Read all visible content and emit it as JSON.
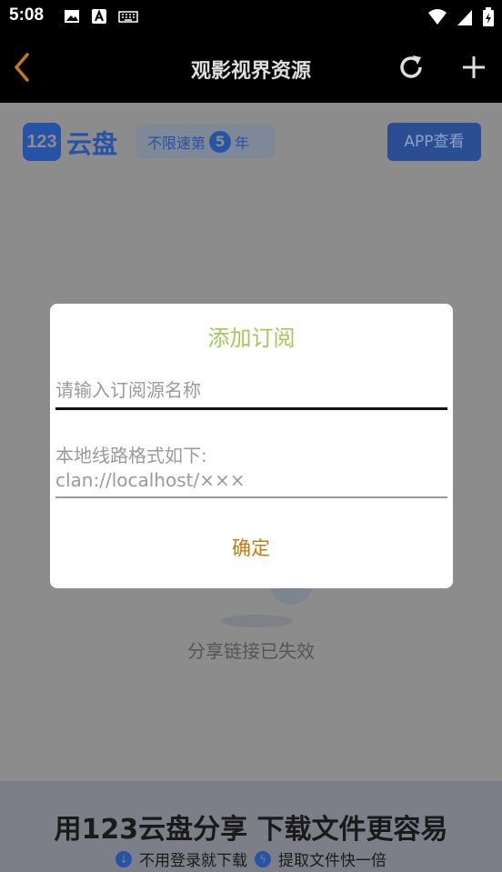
{
  "status_bar": {
    "time": "5:08"
  },
  "app_bar": {
    "title": "观影视界资源"
  },
  "page": {
    "logo_number": "123",
    "logo_text": "云盘",
    "promo_prefix": "不限速第",
    "promo_number": "5",
    "promo_suffix": "年",
    "app_view_button": "APP查看",
    "expired_message": "分享链接已失效",
    "banner_title": "用123云盘分享  下载文件更容易",
    "banner_item_1": "不用登录就下载",
    "banner_item_2": "提取文件快一倍"
  },
  "dialog": {
    "title": "添加订阅",
    "name_placeholder": "请输入订阅源名称",
    "url_placeholder": "本地线路格式如下:\nclan://localhost/×××",
    "confirm_label": "确定"
  },
  "colors": {
    "title_green": "#a5c85a",
    "confirm_orange": "#c47a0e",
    "back_orange": "#c47a0e",
    "brand_blue": "#2653a6"
  }
}
